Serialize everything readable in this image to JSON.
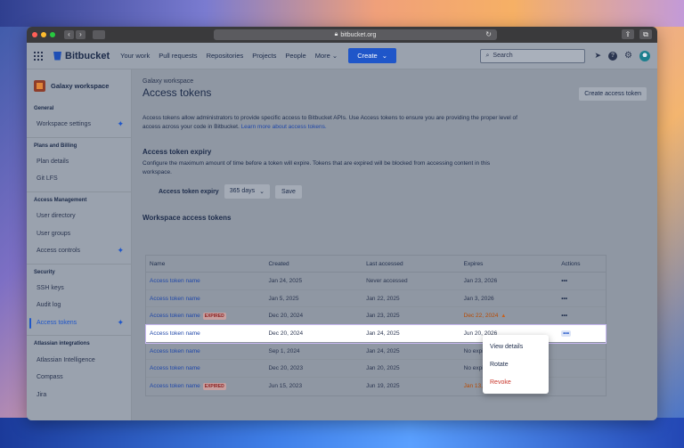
{
  "browser": {
    "url": "bitbucket.org"
  },
  "topnav": {
    "brand": "Bitbucket",
    "links": [
      "Your work",
      "Pull requests",
      "Repositories",
      "Projects",
      "People",
      "More"
    ],
    "create_label": "Create",
    "search_placeholder": "Search"
  },
  "sidebar": {
    "workspace_name": "Galaxy workspace",
    "sections": [
      {
        "title": "General",
        "items": [
          "Workspace settings"
        ]
      },
      {
        "title": "Plans and Billing",
        "items": [
          "Plan details",
          "Git LFS"
        ]
      },
      {
        "title": "Access Management",
        "items": [
          "User directory",
          "User groups",
          "Access controls"
        ]
      },
      {
        "title": "Security",
        "items": [
          "SSH keys",
          "Audit log",
          "Access tokens"
        ]
      },
      {
        "title": "Atlassian integrations",
        "items": [
          "Atlassian Intelligence",
          "Compass",
          "Jira"
        ]
      }
    ],
    "active_item": "Access tokens"
  },
  "page": {
    "breadcrumb": "Galaxy workspace",
    "title": "Access tokens",
    "create_button": "Create access token",
    "intro": "Access tokens allow administrators to provide specific access to Bitbucket APIs. Use Access tokens to ensure you are providing the proper level of access across your code in Bitbucket.",
    "intro_link": "Learn more about access tokens.",
    "expiry_title": "Access token expiry",
    "expiry_desc": "Configure the maximum amount of time before a token will expire. Tokens that are expired will be blocked from accessing content in this workspace.",
    "expiry_label": "Access token expiry",
    "expiry_value": "365 days",
    "save_label": "Save",
    "table_title": "Workspace access tokens"
  },
  "table": {
    "columns": [
      "Name",
      "Created",
      "Last accessed",
      "Expires",
      "Actions"
    ],
    "rows": [
      {
        "name": "Access token name",
        "expired": false,
        "created": "Jan 24, 2025",
        "last": "Never accessed",
        "expires": "Jan 23, 2026",
        "warn": false
      },
      {
        "name": "Access token name",
        "expired": false,
        "created": "Jan 5, 2025",
        "last": "Jan 22, 2025",
        "expires": "Jan 3, 2026",
        "warn": false
      },
      {
        "name": "Access token name",
        "expired": true,
        "created": "Dec 20, 2024",
        "last": "Jan 23, 2025",
        "expires": "Dec 22, 2024",
        "warn": true
      },
      {
        "name": "Access token name",
        "expired": false,
        "created": "Dec 20, 2024",
        "last": "Jan 24, 2025",
        "expires": "Jun 20, 2026",
        "warn": false
      },
      {
        "name": "Access token name",
        "expired": false,
        "created": "Sep 1, 2024",
        "last": "Jan 24, 2025",
        "expires": "No expiry",
        "warn": false
      },
      {
        "name": "Access token name",
        "expired": false,
        "created": "Dec 20, 2023",
        "last": "Jan 20, 2025",
        "expires": "No expiry",
        "warn": false
      },
      {
        "name": "Access token name",
        "expired": true,
        "created": "Jun 15, 2023",
        "last": "Jun 19, 2025",
        "expires": "Jan 13, 2024",
        "warn": true
      }
    ],
    "expired_badge": "EXPIRED",
    "actions_glyph": "•••"
  },
  "menu": {
    "items": [
      "View details",
      "Rotate",
      "Revoke"
    ]
  }
}
